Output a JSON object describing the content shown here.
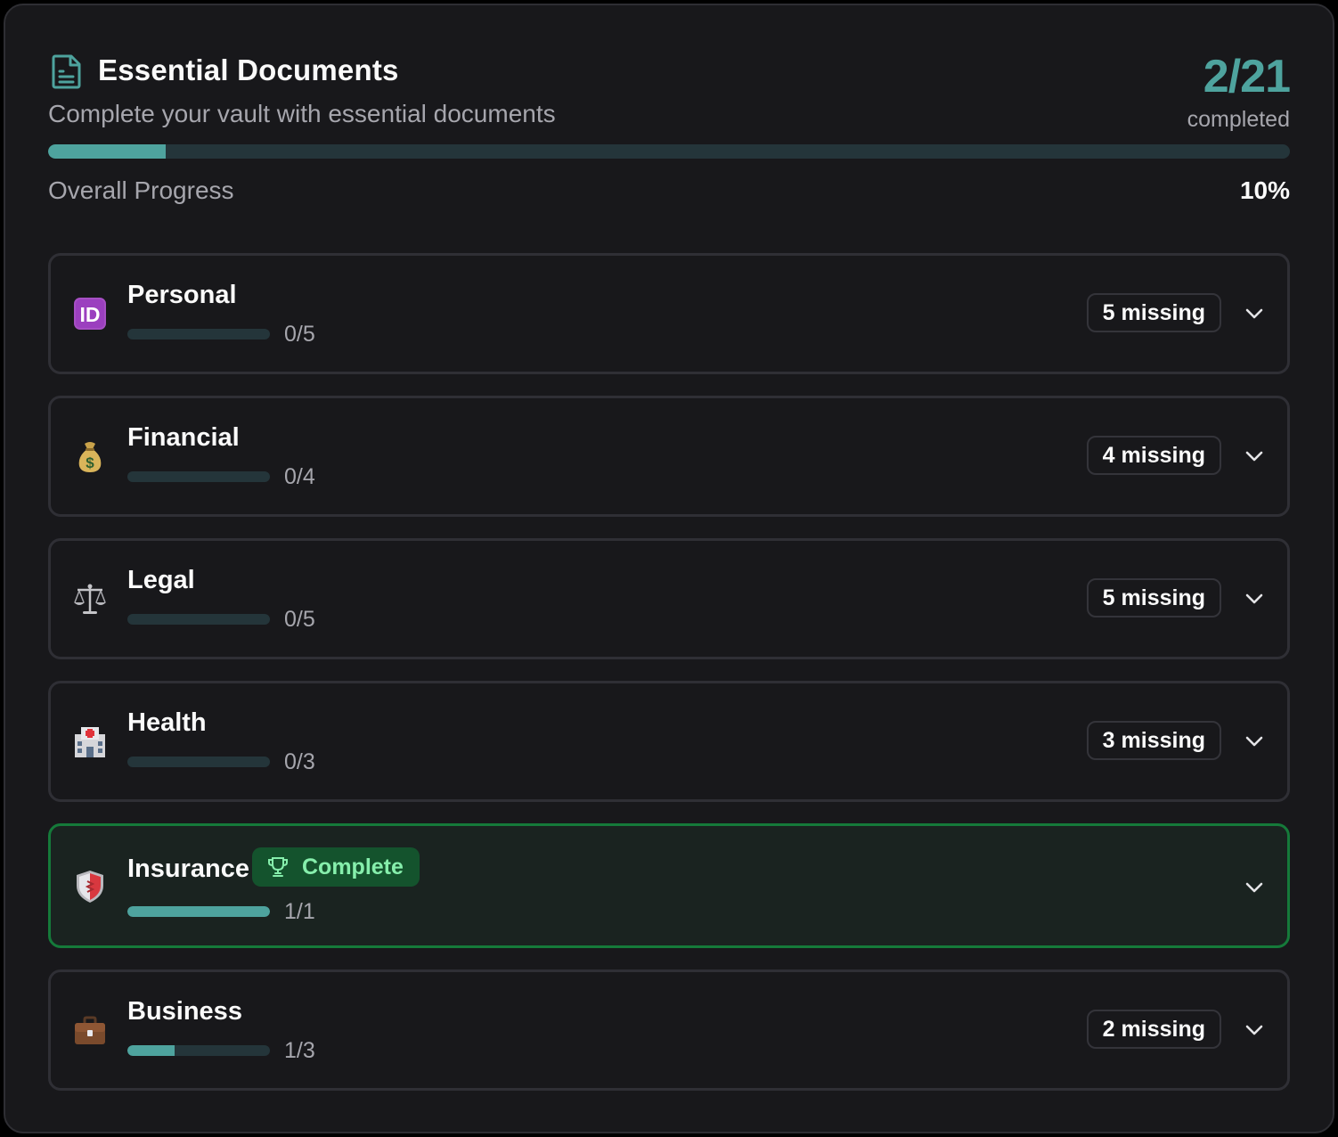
{
  "header": {
    "icon": "document-icon",
    "title": "Essential Documents",
    "subtitle": "Complete your vault with essential documents",
    "count": "2/21",
    "count_label": "completed"
  },
  "overall": {
    "label": "Overall Progress",
    "percent_text": "10%",
    "progress": 0.095
  },
  "colors": {
    "accent": "#4ea39e",
    "track": "#24353a",
    "complete_border": "#157a3a",
    "complete_badge_bg": "#14532d",
    "complete_badge_text": "#86efac"
  },
  "categories": [
    {
      "name": "Personal",
      "icon": "id-icon",
      "fraction": "0/5",
      "progress": 0,
      "missing": "5 missing",
      "complete": false
    },
    {
      "name": "Financial",
      "icon": "money-bag-icon",
      "fraction": "0/4",
      "progress": 0,
      "missing": "4 missing",
      "complete": false
    },
    {
      "name": "Legal",
      "icon": "scales-icon",
      "fraction": "0/5",
      "progress": 0,
      "missing": "5 missing",
      "complete": false
    },
    {
      "name": "Health",
      "icon": "hospital-icon",
      "fraction": "0/3",
      "progress": 0,
      "missing": "3 missing",
      "complete": false
    },
    {
      "name": "Insurance",
      "icon": "shield-icon",
      "fraction": "1/1",
      "progress": 1,
      "badge": "Complete",
      "complete": true
    },
    {
      "name": "Business",
      "icon": "briefcase-icon",
      "fraction": "1/3",
      "progress": 0.333,
      "missing": "2 missing",
      "complete": false
    }
  ]
}
